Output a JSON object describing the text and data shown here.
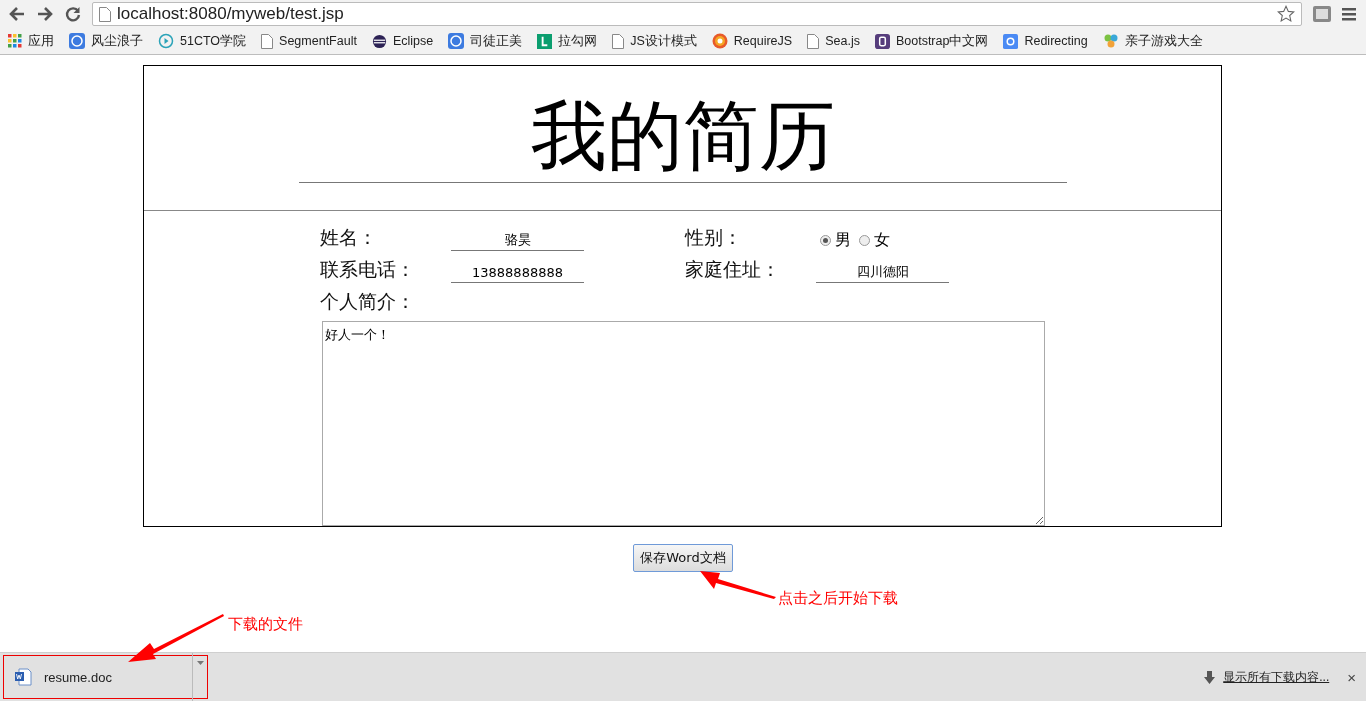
{
  "browser": {
    "url": "localhost:8080/myweb/test.jsp",
    "bookmarks": [
      {
        "label": "应用",
        "kind": "apps"
      },
      {
        "label": "风尘浪子",
        "kind": "blue"
      },
      {
        "label": "51CTO学院",
        "kind": "play"
      },
      {
        "label": "SegmentFault",
        "kind": "page"
      },
      {
        "label": "Eclipse",
        "kind": "eclipse"
      },
      {
        "label": "司徒正美",
        "kind": "blue"
      },
      {
        "label": "拉勾网",
        "kind": "green"
      },
      {
        "label": "JS设计模式",
        "kind": "page"
      },
      {
        "label": "RequireJS",
        "kind": "target"
      },
      {
        "label": "Sea.js",
        "kind": "page"
      },
      {
        "label": "Bootstrap中文网",
        "kind": "purple"
      },
      {
        "label": "Redirecting",
        "kind": "google"
      },
      {
        "label": "亲子游戏大全",
        "kind": "leaf"
      }
    ]
  },
  "resume": {
    "title": "我的简历",
    "name": {
      "label": "姓名：",
      "value": "骆昊"
    },
    "gender": {
      "label": "性别：",
      "options": [
        {
          "label": "男",
          "selected": true
        },
        {
          "label": "女",
          "selected": false
        }
      ]
    },
    "phone": {
      "label": "联系电话：",
      "value": "13888888888"
    },
    "address": {
      "label": "家庭住址：",
      "value": "四川德阳"
    },
    "intro": {
      "label": "个人简介：",
      "value": "好人一个！"
    },
    "save_button": "保存Word文档"
  },
  "annotations": [
    {
      "text": "点击之后开始下载"
    },
    {
      "text": "下载的文件"
    }
  ],
  "downloads_bar": {
    "file": "resume.doc",
    "show_all": "显示所有下载内容...",
    "close": "×"
  }
}
